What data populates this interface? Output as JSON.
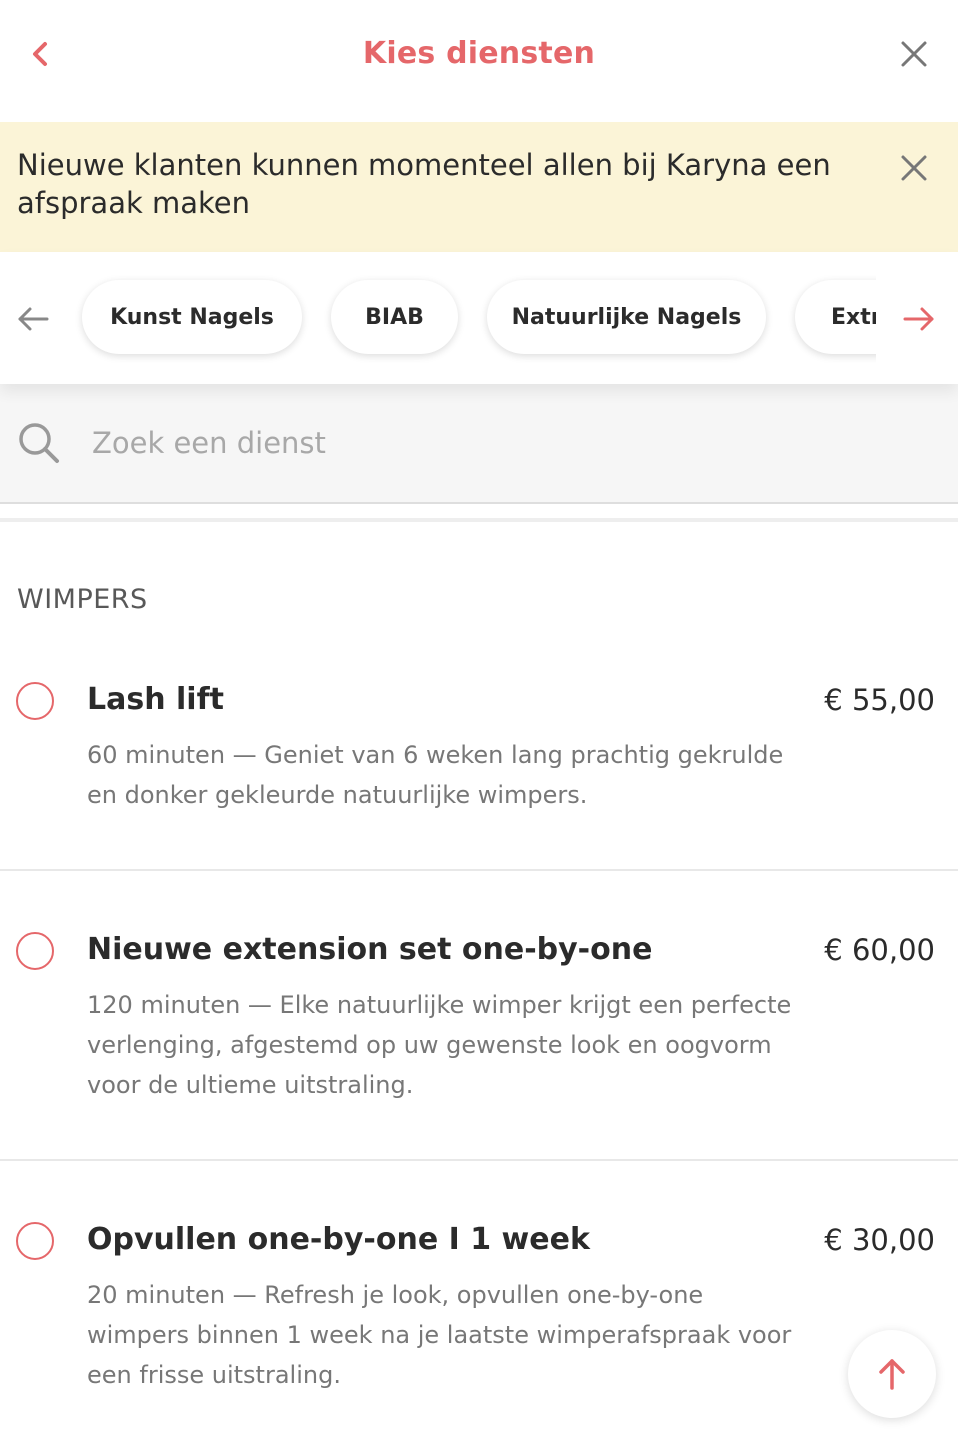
{
  "header": {
    "title": "Kies diensten",
    "back_icon": "chevron-left-icon",
    "close_icon": "close-icon"
  },
  "notice": {
    "text": "Nieuwe klanten kunnen momenteel allen bij Karyna een afspraak maken",
    "close_icon": "close-icon"
  },
  "categories": {
    "prev_icon": "arrow-left-icon",
    "next_icon": "arrow-right-icon",
    "items": [
      {
        "label": "Kunst Nagels"
      },
      {
        "label": "BIAB"
      },
      {
        "label": "Natuurlijke Nagels"
      },
      {
        "label": "Extr"
      }
    ]
  },
  "search": {
    "placeholder": "Zoek een dienst",
    "value": "",
    "icon": "search-icon"
  },
  "section": {
    "title": "WIMPERS",
    "services": [
      {
        "name": "Lash lift",
        "price": "€ 55,00",
        "description": "60 minuten — Geniet van 6 weken lang prachtig gekrulde en donker gekleurde natuurlijke wimpers."
      },
      {
        "name": "Nieuwe extension set one-by-one",
        "price": "€ 60,00",
        "description": "120 minuten — Elke natuurlijke wimper krijgt een perfecte verlenging, afgestemd op uw gewenste look en oogvorm voor de ultieme uitstraling."
      },
      {
        "name": "Opvullen one-by-one I 1 week",
        "price": "€ 30,00",
        "description": "20 minuten — Refresh je look, opvullen one-by-one wimpers binnen 1 week na je laatste wimperafspraak voor een frisse uitstraling."
      }
    ]
  },
  "scroll_top_icon": "arrow-up-icon",
  "colors": {
    "accent": "#e5676a",
    "notice_bg": "#fbf4d7",
    "text": "#2b2b2b",
    "muted": "#777777"
  }
}
